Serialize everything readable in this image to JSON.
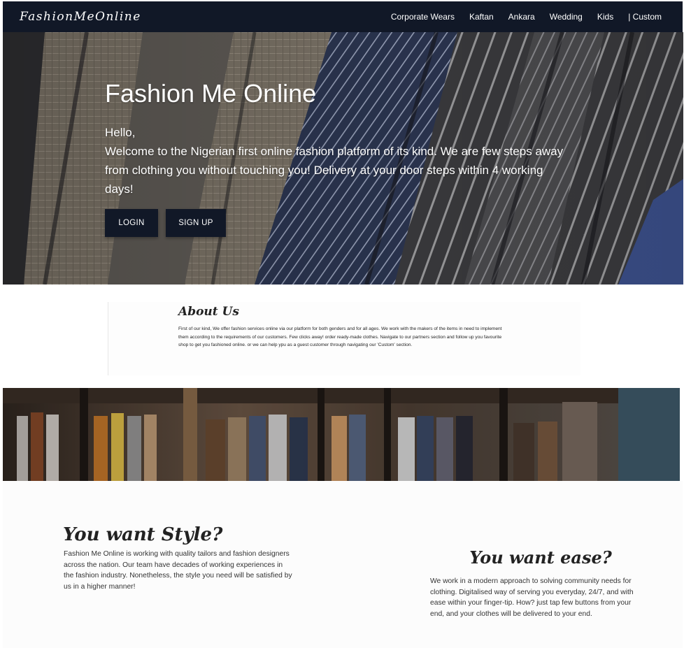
{
  "navbar": {
    "brand": "FashionMeOnline",
    "links": [
      "Corporate Wears",
      "Kaftan",
      "Ankara",
      "Wedding",
      "Kids",
      "| Custom"
    ]
  },
  "hero": {
    "title": "Fashion Me Online",
    "greeting": "Hello,",
    "text": "Welcome to the Nigerian first online fashion platform of its kind. We are few steps away from clothing you without touching you! Delivery at your door steps within 4 working days!",
    "login_label": "LOGIN",
    "signup_label": "SIGN UP"
  },
  "about": {
    "heading": "About Us",
    "text": "First of our kind, We offer fashion services online via our platform for both genders and for all ages. We work with the makers of the items in need to implement them according to the requirements of our customers. Few clicks away! order ready-made clothes. Navigate to our partners section and follow up you favourite shop to get you fashioned online. or we can help ypu as a guest customer through navigating our 'Custom' section."
  },
  "style": {
    "heading": "You want Style?",
    "text": "Fashion Me Online is working with quality tailors and fashion designers across the nation. Our team have decades of working experiences in the fashion industry. Nonetheless, the style you need will be satisfied by us in a higher manner!"
  },
  "ease": {
    "heading": "You want ease?",
    "text": "We work in a modern approach to solving community needs for clothing. Digitalised way of serving you everyday, 24/7, and with ease within your finger-tip. How? just tap few buttons from your end, and your clothes will be delivered to your end."
  },
  "colors": {
    "navbar_bg": "#111827",
    "button_bg": "#111827",
    "text_light": "#ffffff"
  }
}
